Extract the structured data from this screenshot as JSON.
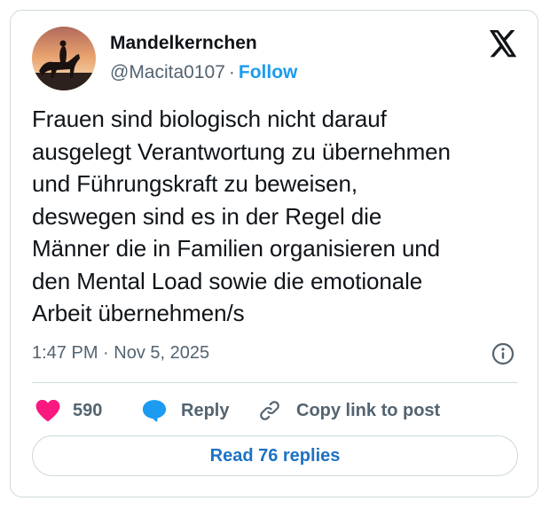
{
  "author": {
    "display_name": "Mandelkernchen",
    "handle": "@Macita0107",
    "separator": "·",
    "follow_label": "Follow"
  },
  "tweet": {
    "text": "Frauen sind biologisch nicht darauf ausgelegt Verantwortung zu übernehmen und Führungskraft zu beweisen, deswegen sind es in der Regel die Männer die in Familien organisieren und den Mental Load sowie die emotionale Arbeit übernehmen/s",
    "lines": [
      "Frauen sind biologisch nicht darauf",
      "ausgelegt Verantwortung zu übernehmen",
      "und Führungskraft zu beweisen,",
      "deswegen sind es in der Regel die",
      "Männer die in Familien organisieren und",
      "den Mental Load sowie die emotionale",
      "Arbeit übernehmen/s"
    ],
    "timestamp": "1:47 PM · Nov 5, 2025"
  },
  "actions": {
    "like_count": "590",
    "reply_label": "Reply",
    "copy_link_label": "Copy link to post"
  },
  "read_replies_label": "Read 76 replies",
  "icons": {
    "brand": "x-logo-icon",
    "info": "info-icon",
    "like": "heart-icon",
    "reply": "speech-bubble-icon",
    "copy": "link-icon"
  },
  "colors": {
    "text_primary": "#0f1419",
    "text_secondary": "#536471",
    "accent_blue": "#1d9bf0",
    "reply_blue": "#1d9bf0",
    "heart_pink": "#f91880",
    "border": "#cfd9de"
  }
}
